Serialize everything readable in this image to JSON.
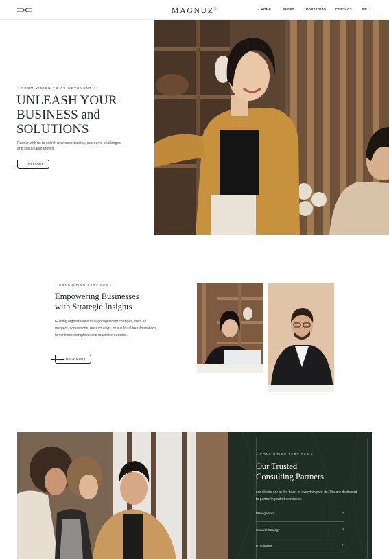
{
  "header": {
    "brand": "MAGNUZ",
    "brand_mark": "®",
    "nav": [
      {
        "label": "HOME",
        "active": true
      },
      {
        "label": "PAGES"
      },
      {
        "label": "PORTFOLIO"
      },
      {
        "label": "CONTACT"
      }
    ],
    "language": "EN"
  },
  "hero": {
    "eyebrow": "+ FROM VISION TO ACHIEVEMENT +",
    "title_line1": "UNLEASH YOUR",
    "title_line2": "BUSINESS and",
    "title_line3": "SOLUTIONS",
    "subtitle": "Partner with us to unlock new opportunities, overcome challenges, and sustainable growth.",
    "button": "EXPLORE"
  },
  "consulting": {
    "eyebrow": "+ CONSULTING SERVICES +",
    "title_line1": "Empowering Businesses",
    "title_line2": "with Strategic Insights",
    "text": "Guiding organizations through significant changes, such as mergers, acquisitions, restructurings, or a cultural transformations, to minimize disruptions and maximize success.",
    "button": "READ MORE"
  },
  "partners": {
    "eyebrow": "+ CONSULTING SERVICES +",
    "title_line1": "Our Trusted",
    "title_line2": "Consulting Partners",
    "text": "our clients are at the heart of everything we do. We are dedicated to partnering with businesses.",
    "services": [
      "Management",
      "Survival Strategy",
      "IT Solutions"
    ]
  },
  "colors": {
    "accent_dark_green": "#1f2f27",
    "text_dark": "#1f2a24"
  }
}
